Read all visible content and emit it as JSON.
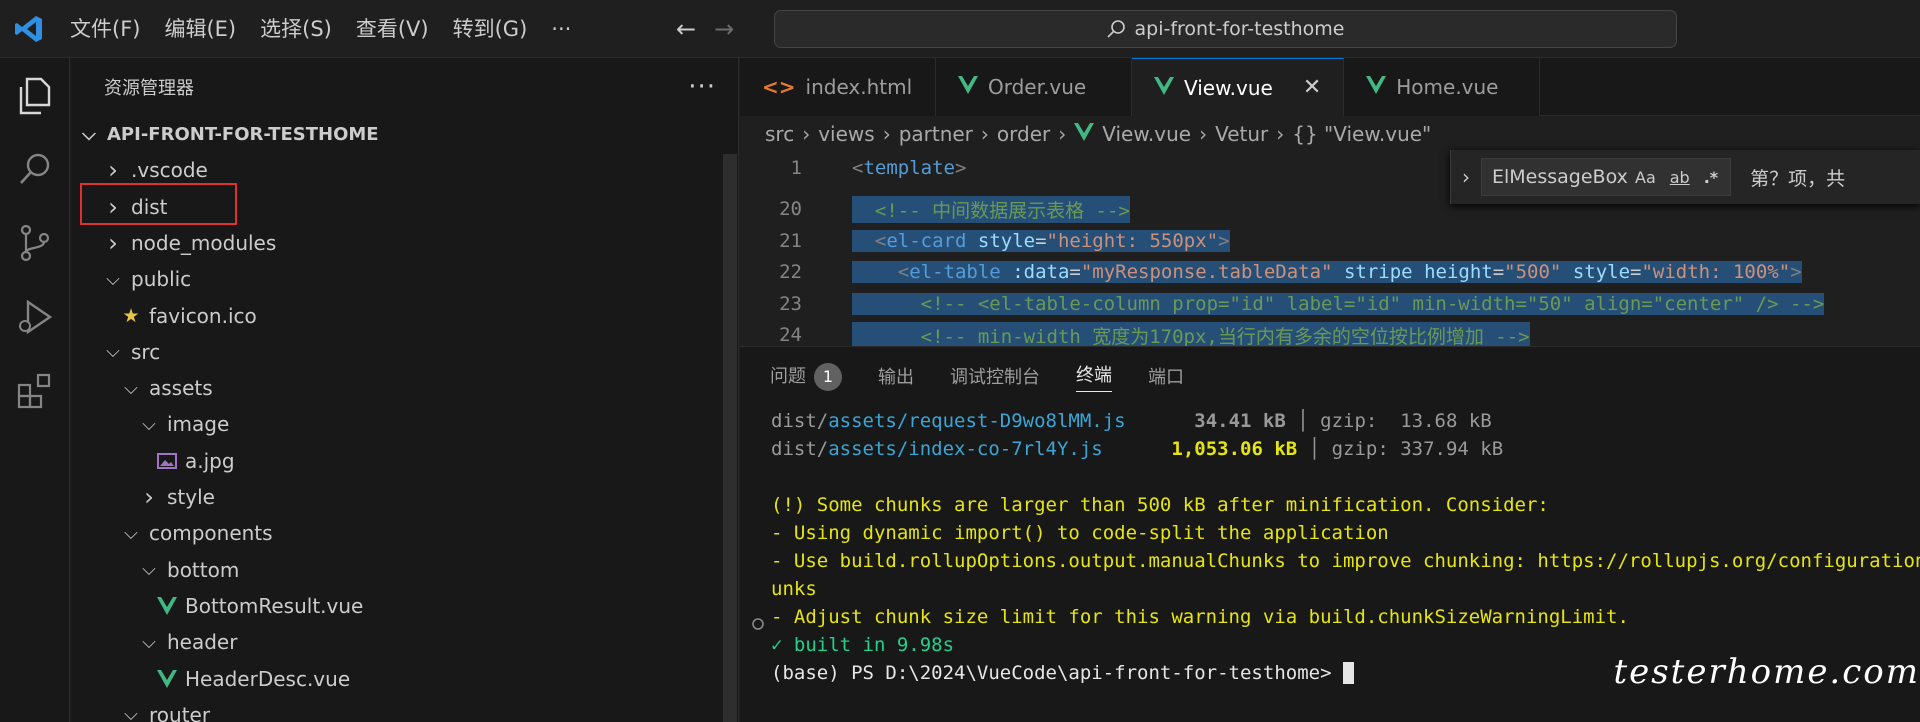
{
  "titlebar": {
    "menu": [
      "文件(F)",
      "编辑(E)",
      "选择(S)",
      "查看(V)",
      "转到(G)",
      "···"
    ],
    "search_text": "api-front-for-testhome"
  },
  "sidebar": {
    "title": "资源管理器",
    "more": "···",
    "tree": [
      {
        "label": "API-FRONT-FOR-TESTHOME",
        "indent": 0,
        "chevron": "open",
        "root": true
      },
      {
        "label": ".vscode",
        "indent": 1,
        "chevron": "closed"
      },
      {
        "label": "dist",
        "indent": 1,
        "chevron": "closed"
      },
      {
        "label": "node_modules",
        "indent": 1,
        "chevron": "closed"
      },
      {
        "label": "public",
        "indent": 1,
        "chevron": "open"
      },
      {
        "label": "favicon.ico",
        "indent": 2,
        "icon": "star"
      },
      {
        "label": "src",
        "indent": 1,
        "chevron": "open"
      },
      {
        "label": "assets",
        "indent": 2,
        "chevron": "open"
      },
      {
        "label": "image",
        "indent": 3,
        "chevron": "open"
      },
      {
        "label": "a.jpg",
        "indent": 4,
        "icon": "image"
      },
      {
        "label": "style",
        "indent": 3,
        "chevron": "closed"
      },
      {
        "label": "components",
        "indent": 2,
        "chevron": "open"
      },
      {
        "label": "bottom",
        "indent": 3,
        "chevron": "open"
      },
      {
        "label": "BottomResult.vue",
        "indent": 4,
        "icon": "vue"
      },
      {
        "label": "header",
        "indent": 3,
        "chevron": "open"
      },
      {
        "label": "HeaderDesc.vue",
        "indent": 4,
        "icon": "vue"
      },
      {
        "label": "router",
        "indent": 2,
        "chevron": "open"
      }
    ]
  },
  "editor": {
    "tabs": [
      {
        "label": "index.html",
        "icon": "html"
      },
      {
        "label": "Order.vue",
        "icon": "vue"
      },
      {
        "label": "View.vue",
        "icon": "vue",
        "active": true
      },
      {
        "label": "Home.vue",
        "icon": "vue"
      }
    ],
    "breadcrumb": [
      "src",
      "views",
      "partner",
      "order",
      "View.vue",
      "Vetur",
      "{} \"View.vue\""
    ],
    "lines": [
      {
        "n": "1",
        "html": "<span style='color:#808080'>&lt;</span><span style='color:#569cd6'>template</span><span style='color:#808080'>&gt;</span>"
      },
      {
        "n": "20",
        "html": "  <span style='color:#6a9955'>&lt;!-- 中间数据展示表格 --&gt;</span>"
      },
      {
        "n": "21",
        "html": "  <span style='color:#808080'>&lt;</span><span style='color:#569cd6'>el-card</span> <span style='color:#9cdcfe'>style</span>=<span style='color:#ce9178'>\"height: 550px\"</span><span style='color:#808080'>&gt;</span>"
      },
      {
        "n": "22",
        "html": "    <span style='color:#808080'>&lt;</span><span style='color:#569cd6'>el-table</span> <span style='color:#9cdcfe'>:data</span>=<span style='color:#ce9178'>\"myResponse.tableData\"</span> <span style='color:#9cdcfe'>stripe</span> <span style='color:#9cdcfe'>height</span>=<span style='color:#ce9178'>\"500\"</span> <span style='color:#9cdcfe'>style</span>=<span style='color:#ce9178'>\"width: 100%\"</span><span style='color:#808080'>&gt;</span>"
      },
      {
        "n": "23",
        "html": "      <span style='color:#6a9955'>&lt;!-- &lt;el-table-column prop=\"id\" label=\"id\" min-width=\"50\" align=\"center\" /&gt; --&gt;</span>"
      },
      {
        "n": "24",
        "html": "      <span style='color:#6a9955'>&lt;!-- min-width 宽度为170px,当行内有多余的空位按比例增加 --&gt;</span>"
      }
    ],
    "find": {
      "value": "ElMessageBox",
      "match_case": "Aa",
      "whole_word": "ab",
      "regex": ".*",
      "result": "第？项，共"
    }
  },
  "panel": {
    "tabs": [
      {
        "label": "问题",
        "badge": "1"
      },
      {
        "label": "输出"
      },
      {
        "label": "调试控制台"
      },
      {
        "label": "终端",
        "active": true
      },
      {
        "label": "端口"
      }
    ],
    "terminal": [
      "<span class='t-dim'>dist/</span><span class='t-cyan'>assets/request-D9wo8lMM.js</span>      <span class='t-dim' style='font-weight:bold'>34.41 kB</span> <span class='t-dim'>│</span> <span class='t-dim'>gzip:  13.68 kB</span>",
      "<span class='t-dim'>dist/</span><span class='t-cyan'>assets/index-co-7rl4Y.js</span>      <span class='t-yel' style='font-weight:bold'>1,053.06 kB</span> <span class='t-dim'>│</span> <span class='t-dim'>gzip: 337.94 kB</span>",
      "",
      "<span class='t-yel'>(!) Some chunks are larger than 500 kB after minification. Consider:</span>",
      "<span class='t-yel'>- Using dynamic import() to code-split the application</span>",
      "<span class='t-yel'>- Use build.rollupOptions.output.manualChunks to improve chunking: https://rollupjs.org/configuration-options/#output-manualch</span>",
      "<span class='t-yel'>unks</span>",
      "<span class='t-yel'>- Adjust chunk size limit for this warning via build.chunkSizeWarningLimit.</span>",
      "<span class='t-grn'>✓ built in 9.98s</span>",
      "<span class='t-white'>(base) PS D:\\2024\\VueCode\\api-front-for-testhome&gt; </span><span style='background:#e6e6e6'> </span>"
    ],
    "terminal_text": [
      "dist/assets/request-D9wo8lMM.js 34.41 kB │ gzip: 13.68 kB",
      "dist/assets/index-co-7rl4Y.js 1,053.06 kB │ gzip: 337.94 kB",
      "(!) Some chunks are larger than 500 kB after minification. Consider:",
      "- Using dynamic import() to code-split the application",
      "- Use build.rollupOptions.output.manualChunks to improve chunking: https://rollupjs.org/confi",
      "unks",
      "- Adjust chunk size limit for this warning via build.chunkSizeWarningLimit.",
      "✓ built in 9.98s",
      "(base) PS D:\\2024\\VueCode\\api-front-for-testhome>"
    ]
  },
  "watermark": "testerhome.com",
  "colors": {
    "vue_green": "#41b883",
    "selection_outline": "#e0312c",
    "accent": "#0078d4"
  }
}
